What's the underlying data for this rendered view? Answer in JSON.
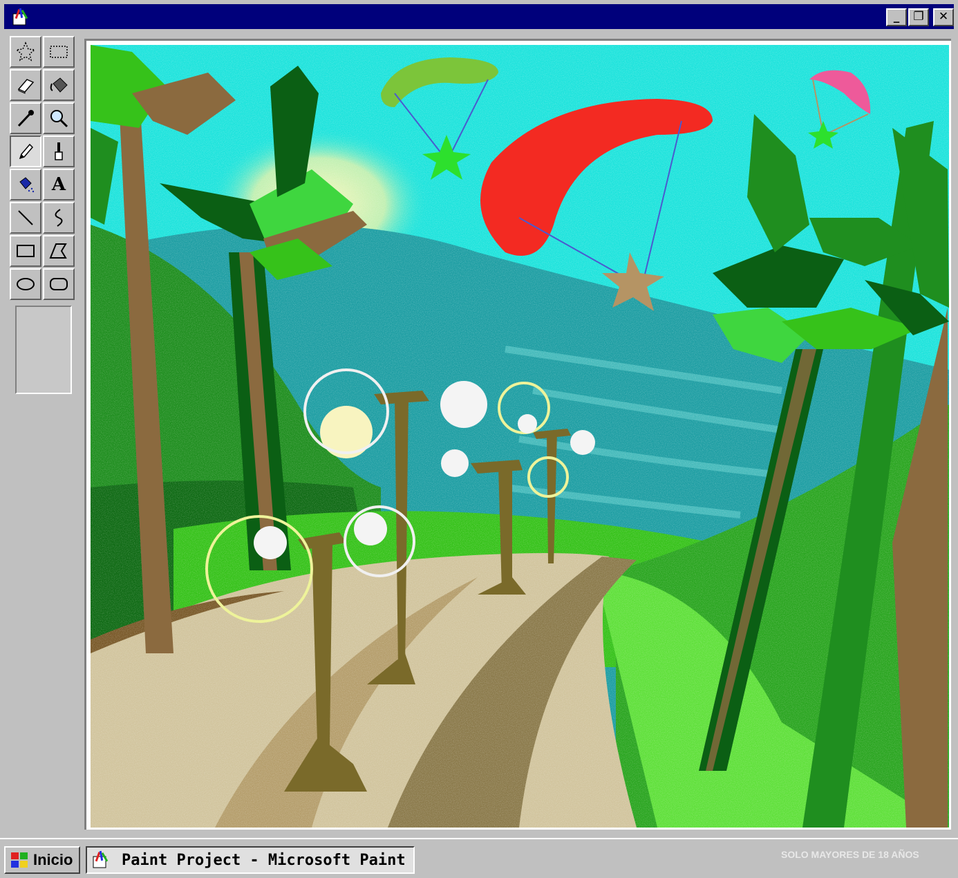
{
  "window": {
    "title": "",
    "controls": {
      "minimize": "_",
      "maximize": "❐",
      "close": "✕"
    }
  },
  "toolbox": {
    "tools": [
      {
        "name": "free-form-select",
        "icon": "star-select-icon"
      },
      {
        "name": "select",
        "icon": "rect-select-icon"
      },
      {
        "name": "eraser",
        "icon": "eraser-icon"
      },
      {
        "name": "fill-with-color",
        "icon": "paint-bucket-icon"
      },
      {
        "name": "pick-color",
        "icon": "eyedropper-icon"
      },
      {
        "name": "magnifier",
        "icon": "magnifier-icon"
      },
      {
        "name": "pencil",
        "icon": "pencil-icon",
        "active": true
      },
      {
        "name": "brush",
        "icon": "brush-icon"
      },
      {
        "name": "airbrush",
        "icon": "airbrush-icon"
      },
      {
        "name": "text",
        "icon": "text-icon",
        "label": "A"
      },
      {
        "name": "line",
        "icon": "line-icon"
      },
      {
        "name": "curve",
        "icon": "curve-icon"
      },
      {
        "name": "rectangle",
        "icon": "rectangle-icon"
      },
      {
        "name": "polygon",
        "icon": "polygon-icon"
      },
      {
        "name": "ellipse",
        "icon": "ellipse-icon"
      },
      {
        "name": "rounded-rectangle",
        "icon": "rounded-rect-icon"
      }
    ]
  },
  "colors": {
    "sky": "#1ee3dc",
    "sea": "#1e9ea3",
    "grass": "#36c21a",
    "road": "#d1c49d",
    "trunk": "#8b6a3f",
    "parachute_red": "#f32a22",
    "parachute_green": "#7cc53a",
    "parachute_pink": "#ee5a9a",
    "palm_dark": "#0b5f14",
    "palm_mid": "#1f8e1f",
    "palm_light": "#3fd63f"
  },
  "taskbar": {
    "start_label": "Inicio",
    "task_label": "Paint Project - Microsoft Paint",
    "watermark": "SOLO MAYORES DE 18 AÑOS"
  }
}
